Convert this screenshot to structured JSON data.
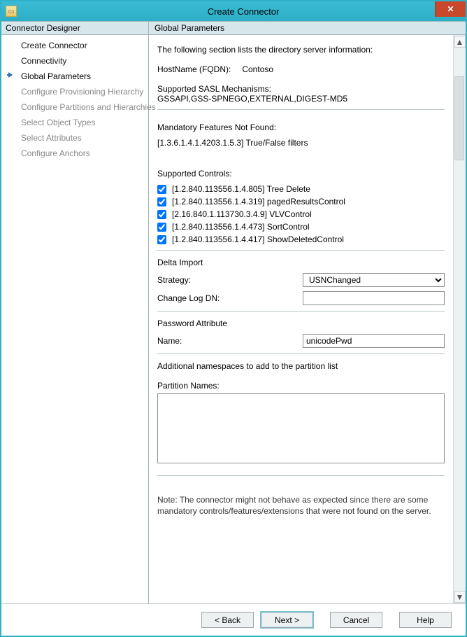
{
  "window": {
    "title": "Create Connector",
    "close_glyph": "✕",
    "app_icon_glyph": "▭"
  },
  "left": {
    "header": "Connector Designer",
    "items": [
      {
        "label": "Create Connector",
        "state": "step"
      },
      {
        "label": "Connectivity",
        "state": "step"
      },
      {
        "label": "Global Parameters",
        "state": "current"
      },
      {
        "label": "Configure Provisioning Hierarchy",
        "state": "disabled"
      },
      {
        "label": "Configure Partitions and Hierarchies",
        "state": "disabled"
      },
      {
        "label": "Select Object Types",
        "state": "disabled"
      },
      {
        "label": "Select Attributes",
        "state": "disabled"
      },
      {
        "label": "Configure Anchors",
        "state": "disabled"
      }
    ]
  },
  "right": {
    "header": "Global Parameters",
    "intro": "The following section lists the directory server information:",
    "hostname_label": "HostName (FQDN):",
    "hostname_value": "Contoso",
    "sasl_label": "Supported SASL Mechanisms:",
    "sasl_value": "GSSAPI,GSS-SPNEGO,EXTERNAL,DIGEST-MD5",
    "mandatory_heading": "Mandatory Features Not Found:",
    "mandatory_value": "[1.3.6.1.4.1.4203.1.5.3] True/False filters",
    "controls_heading": "Supported Controls:",
    "controls": [
      {
        "checked": true,
        "label": "[1.2.840.113556.1.4.805] Tree Delete"
      },
      {
        "checked": true,
        "label": "[1.2.840.113556.1.4.319] pagedResultsControl"
      },
      {
        "checked": true,
        "label": "[2.16.840.1.113730.3.4.9] VLVControl"
      },
      {
        "checked": true,
        "label": "[1.2.840.113556.1.4.473] SortControl"
      },
      {
        "checked": true,
        "label": "[1.2.840.113556.1.4.417] ShowDeletedControl"
      }
    ],
    "delta_heading": "Delta Import",
    "strategy_label": "Strategy:",
    "strategy_value": "USNChanged",
    "changelog_label": "Change Log DN:",
    "changelog_value": "",
    "pwd_heading": "Password Attribute",
    "pwd_name_label": "Name:",
    "pwd_name_value": "unicodePwd",
    "ns_intro": "Additional namespaces to add to the partition list",
    "partition_label": "Partition Names:",
    "partition_value": "",
    "note": "Note: The connector might not behave as expected since there are some mandatory controls/features/extensions that were not found on the server."
  },
  "buttons": {
    "back": "<  Back",
    "next": "Next  >",
    "cancel": "Cancel",
    "help": "Help"
  },
  "scrollbar": {
    "up_glyph": "▲",
    "down_glyph": "▼"
  }
}
